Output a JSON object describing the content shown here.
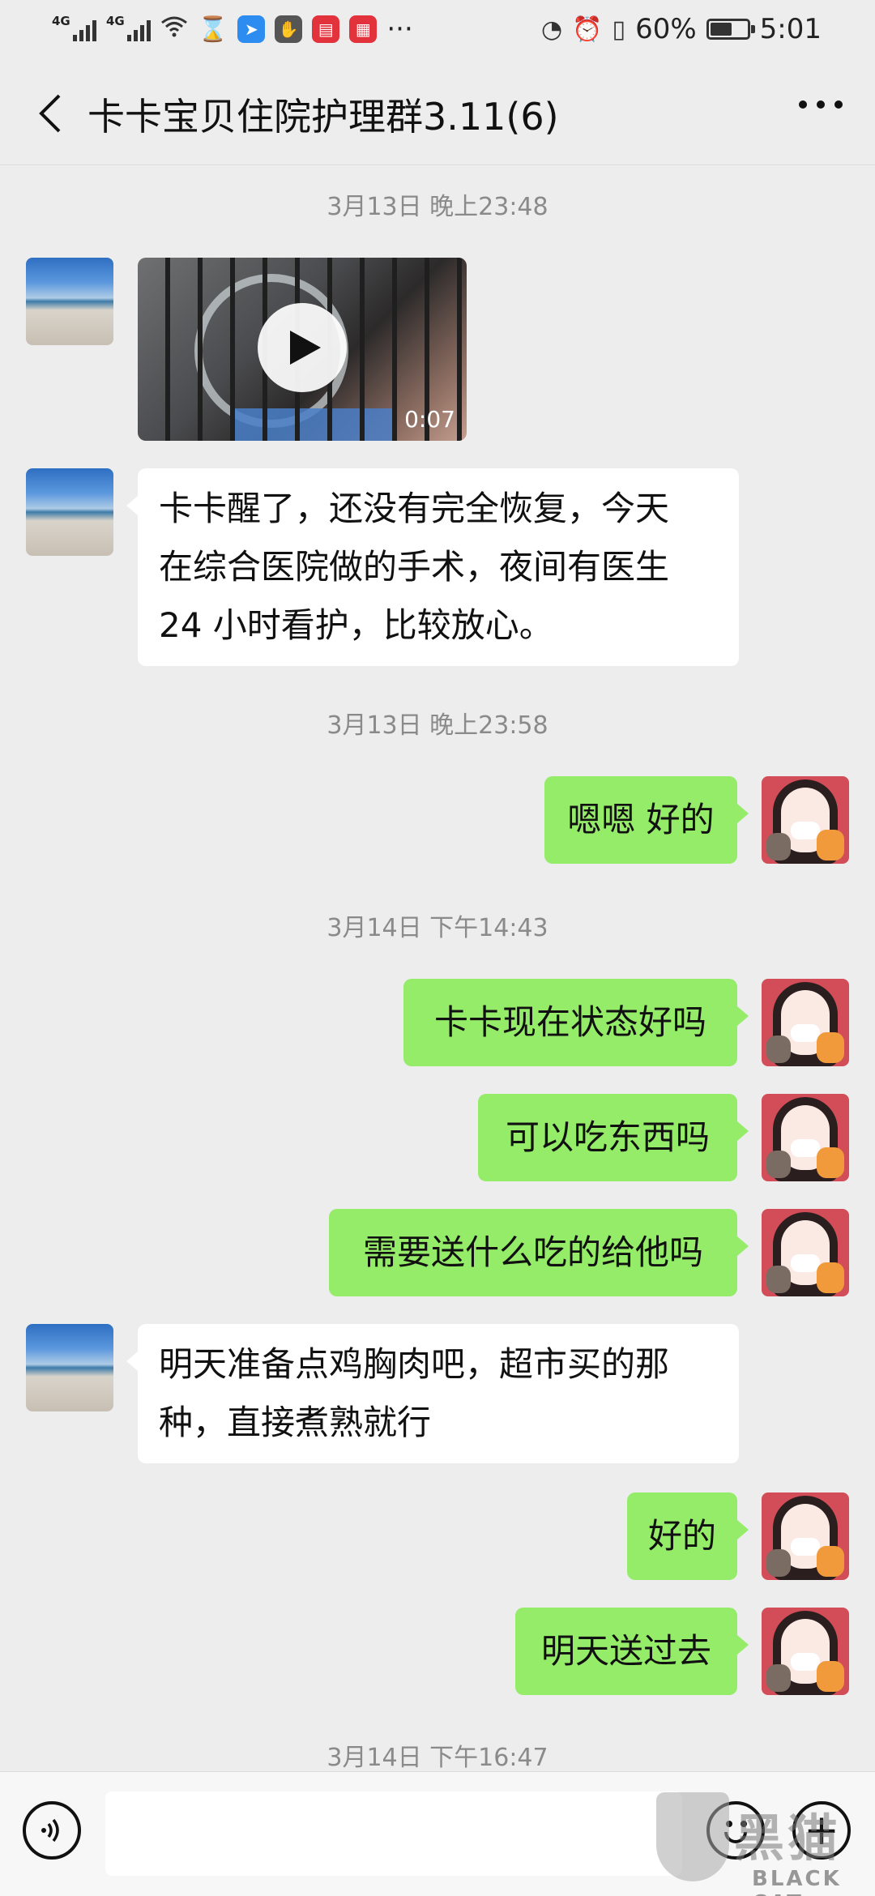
{
  "status_bar": {
    "signal1_label": "4G",
    "signal2_label": "4G",
    "more_dots": "···",
    "battery_text": "60%",
    "battery_level": 0.6,
    "time": "5:01",
    "icons": [
      "signal-4g-icon",
      "signal-4g-icon",
      "wifi-icon",
      "hourglass-icon",
      "app-icon",
      "hand-icon",
      "book-icon",
      "calendar-icon",
      "nfc-icon",
      "alarm-icon",
      "vibrate-icon",
      "battery-icon"
    ]
  },
  "header": {
    "title": "卡卡宝贝住院护理群3.11(6)"
  },
  "timestamps": [
    "3月13日 晚上23:48",
    "3月13日 晚上23:58",
    "3月14日 下午14:43",
    "3月14日 下午16:47"
  ],
  "messages": {
    "video_duration": "0:07",
    "in1_line1": "卡卡醒了，还没有完全恢复，今天",
    "in1_line2": "在综合医院做的手术，夜间有医生",
    "in1_line3": "24 小时看护，比较放心。",
    "out1": "嗯嗯 好的",
    "out2": "卡卡现在状态好吗",
    "out3": "可以吃东西吗",
    "out4": "需要送什么吃的给他吗",
    "in2_line1": "明天准备点鸡胸肉吧，超市买的那",
    "in2_line2": "种，直接煮熟就行",
    "out5": "好的",
    "out6": "明天送过去"
  },
  "input": {
    "value": "",
    "plus_glyph": "+"
  },
  "watermark": {
    "big": "黑猫",
    "small": "BLACK CAT"
  },
  "colors": {
    "background": "#ededed",
    "bubble_out": "#95ec69",
    "bubble_in": "#ffffff"
  }
}
